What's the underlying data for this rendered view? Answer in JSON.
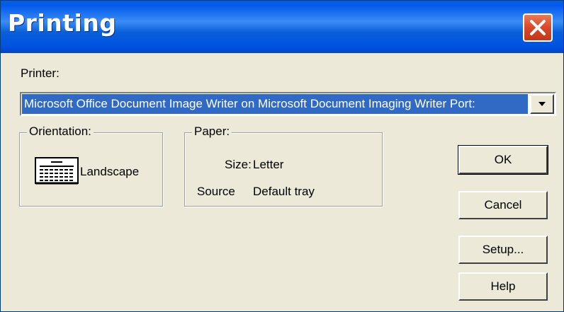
{
  "window": {
    "title": "Printing"
  },
  "printer": {
    "label": "Printer:",
    "selected": "Microsoft Office Document Image Writer on Microsoft Document Imaging Writer Port:"
  },
  "orientation": {
    "label": "Orientation:",
    "value": "Landscape",
    "icon": "landscape-page-icon"
  },
  "paper": {
    "label": "Paper:",
    "size_label": "Size:",
    "size_value": "Letter",
    "source_label": "Source",
    "source_value": "Default tray"
  },
  "buttons": {
    "ok": "OK",
    "cancel": "Cancel",
    "setup": "Setup...",
    "help": "Help"
  },
  "colors": {
    "titlebar": "#0a5fd8",
    "selection": "#316ac5",
    "close": "#d8482a",
    "face": "#ece9d8"
  }
}
